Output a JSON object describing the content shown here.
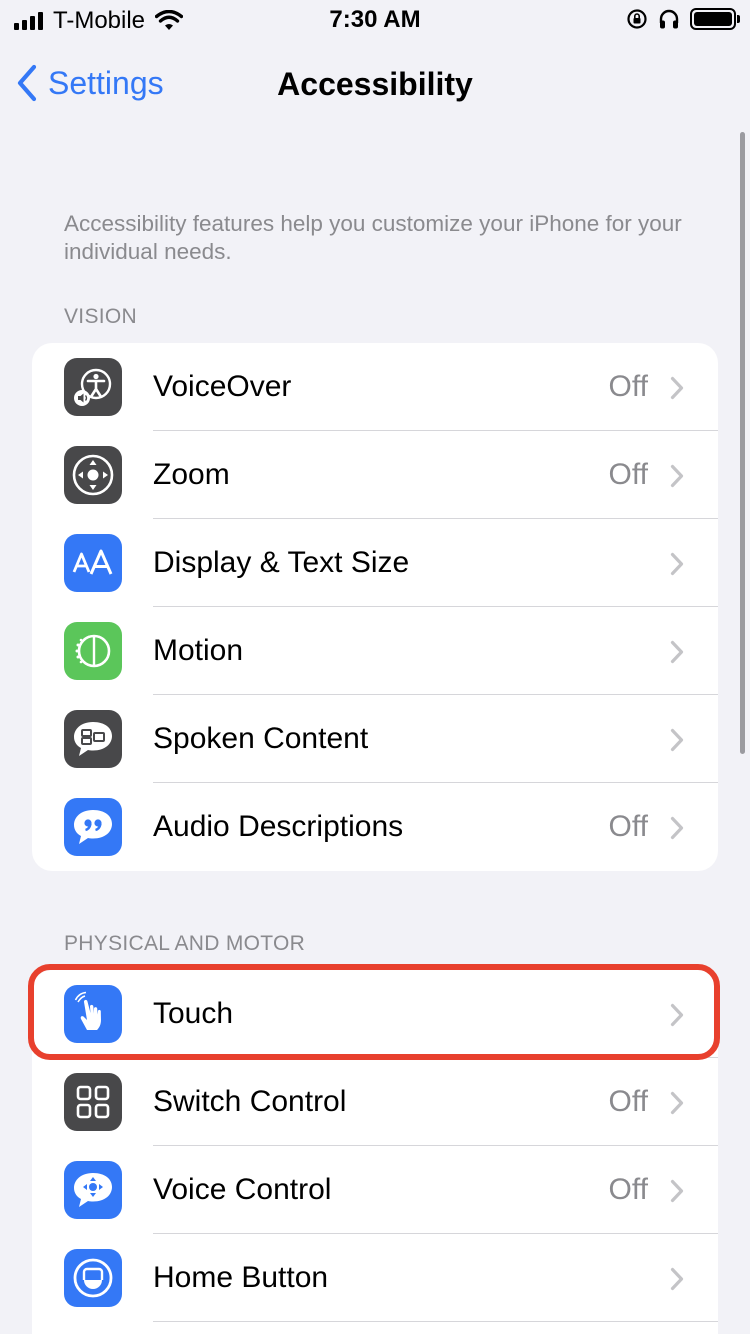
{
  "status_bar": {
    "carrier": "T-Mobile",
    "time": "7:30 AM"
  },
  "nav": {
    "back_label": "Settings",
    "title": "Accessibility"
  },
  "intro": "Accessibility features help you customize your iPhone for your individual needs.",
  "sections": {
    "vision": {
      "header": "VISION",
      "items": [
        {
          "label": "VoiceOver",
          "value": "Off",
          "icon": "voiceover-icon",
          "color": "#48484a"
        },
        {
          "label": "Zoom",
          "value": "Off",
          "icon": "zoom-icon",
          "color": "#48484a"
        },
        {
          "label": "Display & Text Size",
          "value": "",
          "icon": "display-text-size-icon",
          "color": "#3478f6"
        },
        {
          "label": "Motion",
          "value": "",
          "icon": "motion-icon",
          "color": "#5bc65a"
        },
        {
          "label": "Spoken Content",
          "value": "",
          "icon": "spoken-content-icon",
          "color": "#48484a"
        },
        {
          "label": "Audio Descriptions",
          "value": "Off",
          "icon": "audio-descriptions-icon",
          "color": "#3478f6"
        }
      ]
    },
    "physical": {
      "header": "PHYSICAL AND MOTOR",
      "items": [
        {
          "label": "Touch",
          "value": "",
          "icon": "touch-hand-icon",
          "color": "#3478f6"
        },
        {
          "label": "Switch Control",
          "value": "Off",
          "icon": "switch-control-icon",
          "color": "#48484a"
        },
        {
          "label": "Voice Control",
          "value": "Off",
          "icon": "voice-control-icon",
          "color": "#3478f6"
        },
        {
          "label": "Home Button",
          "value": "",
          "icon": "home-button-icon",
          "color": "#3478f6"
        }
      ]
    }
  },
  "highlight_color": "#e8402d",
  "accent": "#3478f6"
}
